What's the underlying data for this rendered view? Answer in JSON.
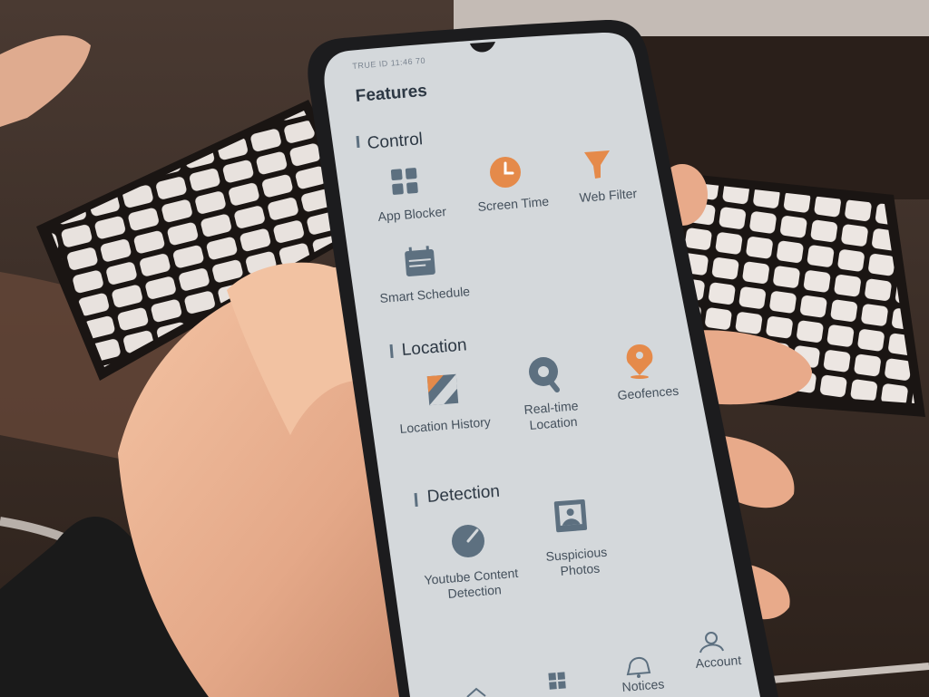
{
  "status_bar": {
    "text": "TRUE ID 11:46 70"
  },
  "screen": {
    "title": "Features",
    "sections": [
      {
        "heading": "Control",
        "items": [
          {
            "label": "App Blocker",
            "icon": "grid-blocks-icon"
          },
          {
            "label": "Screen Time",
            "icon": "clock-icon"
          },
          {
            "label": "Web Filter",
            "icon": "funnel-icon"
          },
          {
            "label": "Smart Schedule",
            "icon": "calendar-icon"
          }
        ]
      },
      {
        "heading": "Location",
        "items": [
          {
            "label": "Location History",
            "icon": "map-icon"
          },
          {
            "label": "Real-time Location",
            "line1": "Real-time",
            "line2": "Location",
            "icon": "location-search-icon"
          },
          {
            "label": "Geofences",
            "icon": "pin-icon"
          }
        ]
      },
      {
        "heading": "Detection",
        "items": [
          {
            "label": "Youtube Content Detection",
            "line1": "Youtube Content",
            "line2": "Detection",
            "icon": "dial-icon"
          },
          {
            "label": "Suspicious Photos",
            "line1": "Suspicious",
            "line2": "Photos",
            "icon": "photo-icon"
          }
        ]
      }
    ],
    "bottom_nav": [
      {
        "label": "",
        "icon": "home-icon"
      },
      {
        "label": "",
        "icon": "features-grid-icon"
      },
      {
        "label": "Notices",
        "icon": "bell-icon"
      },
      {
        "label": "Account",
        "icon": "person-icon"
      }
    ]
  },
  "colors": {
    "accent_orange": "#e58a4a",
    "icon_slate": "#5d7080",
    "screen_bg": "#d4d8db",
    "phone_frame": "#1c1c1e"
  }
}
